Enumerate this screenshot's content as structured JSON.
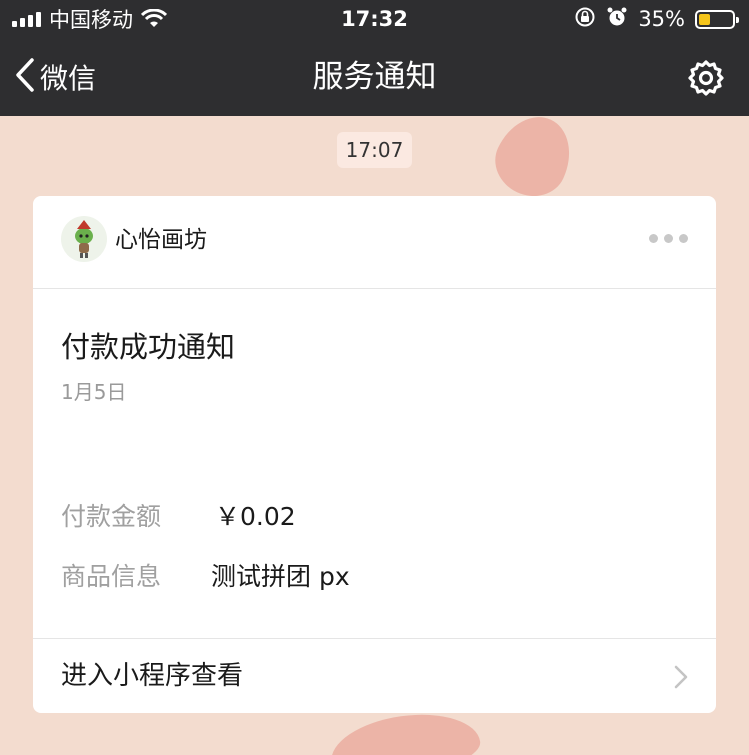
{
  "status_bar": {
    "carrier": "中国移动",
    "time": "17:32",
    "battery_percent": "35%",
    "battery_level": 0.35,
    "battery_color": "#f5c51a"
  },
  "nav": {
    "back_label": "微信",
    "title": "服务通知",
    "settings_icon": "gear-icon"
  },
  "chat": {
    "timestamp": "17:07"
  },
  "card": {
    "sender_name": "心怡画坊",
    "title": "付款成功通知",
    "date": "1月5日",
    "rows": [
      {
        "label": "付款金额",
        "value": "￥0.02"
      },
      {
        "label": "商品信息",
        "value": "测试拼团 px"
      }
    ],
    "footer_link": "进入小程序查看"
  },
  "colors": {
    "bar_background": "#2e2e30",
    "page_background": "#f3dccf",
    "card_background": "#ffffff"
  }
}
